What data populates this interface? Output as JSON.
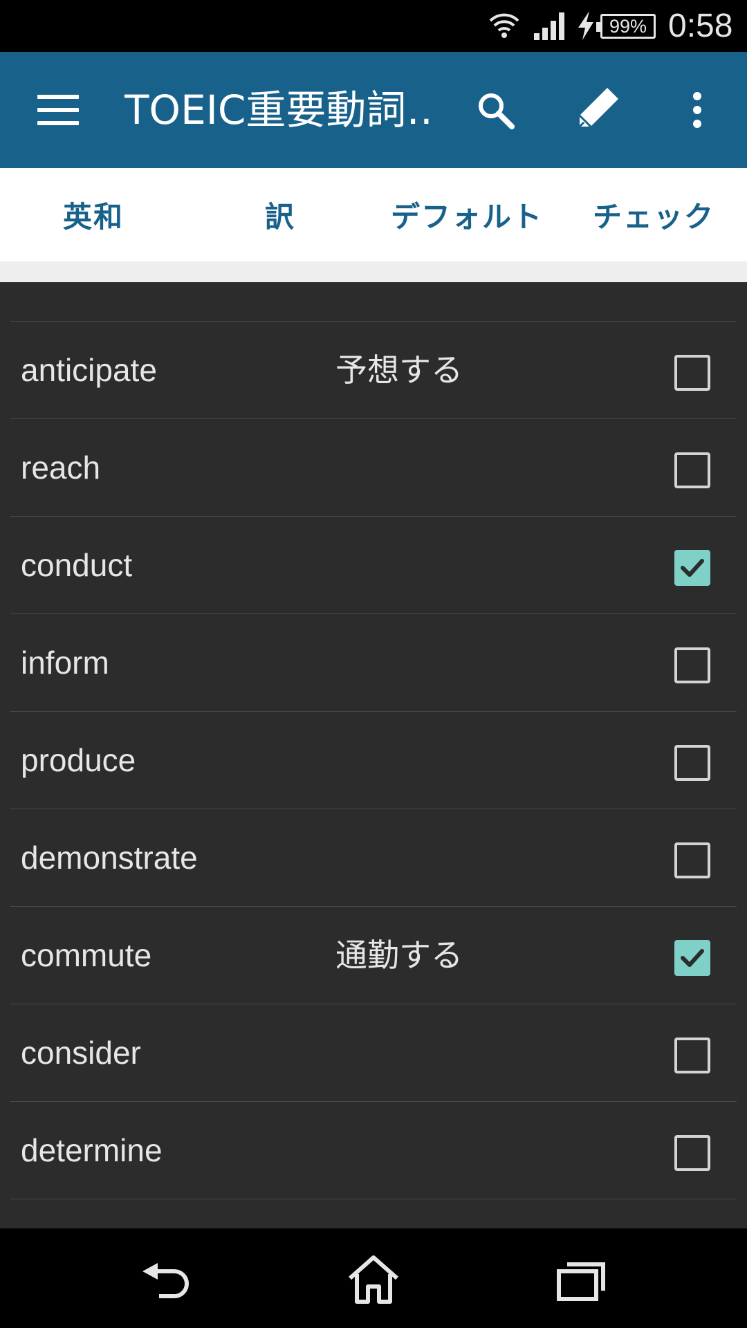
{
  "status_bar": {
    "battery": "99%",
    "time": "0:58"
  },
  "app_bar": {
    "title": "TOEIC重要動詞…"
  },
  "tabs": [
    {
      "label": "英和"
    },
    {
      "label": "訳"
    },
    {
      "label": "デフォルト"
    },
    {
      "label": "チェック"
    }
  ],
  "words": [
    {
      "word": "anticipate",
      "meaning": "予想する",
      "checked": false
    },
    {
      "word": "reach",
      "meaning": "",
      "checked": false
    },
    {
      "word": "conduct",
      "meaning": "",
      "checked": true
    },
    {
      "word": "inform",
      "meaning": "",
      "checked": false
    },
    {
      "word": "produce",
      "meaning": "",
      "checked": false
    },
    {
      "word": "demonstrate",
      "meaning": "",
      "checked": false
    },
    {
      "word": "commute",
      "meaning": "通勤する",
      "checked": true
    },
    {
      "word": "consider",
      "meaning": "",
      "checked": false
    },
    {
      "word": "determine",
      "meaning": "",
      "checked": false
    }
  ],
  "colors": {
    "app_bar": "#17618a",
    "accent_check": "#7fd0c6",
    "list_bg": "#2c2c2c"
  },
  "icons": {
    "menu": "hamburger-icon",
    "search": "search-icon",
    "edit": "pencil-icon",
    "overflow": "more-vert-icon",
    "back": "back-icon",
    "home": "home-icon",
    "recents": "recents-icon"
  }
}
